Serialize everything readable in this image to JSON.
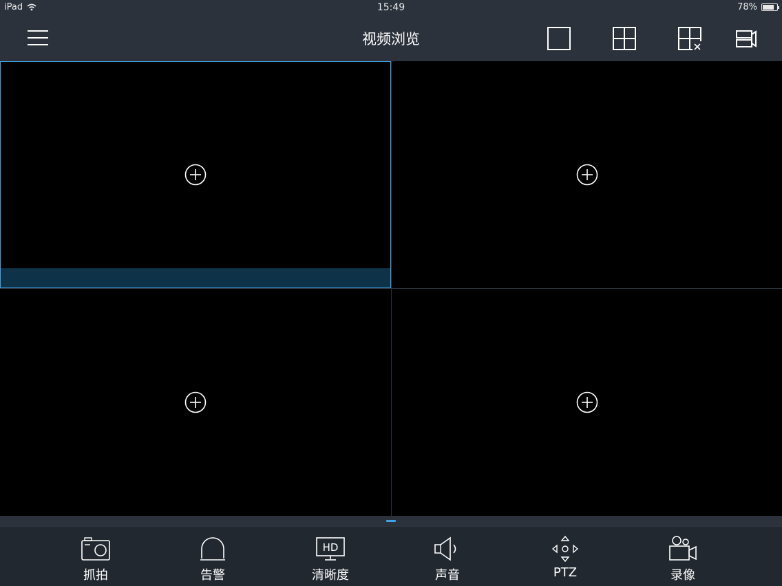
{
  "status_bar": {
    "device": "iPad",
    "time": "15:49",
    "battery": "78%",
    "battery_level": 0.78
  },
  "header": {
    "title": "视频浏览",
    "menu_icon": "hamburger-icon",
    "layout_single_icon": "single-view-icon",
    "layout_quad_icon": "quad-view-icon",
    "close_all_icon": "close-all-views-icon",
    "record_list_icon": "camera-list-icon"
  },
  "video_grid": {
    "cells": [
      {
        "name": "video-cell-1",
        "selected": true,
        "icon": "add-circle-icon"
      },
      {
        "name": "video-cell-2",
        "selected": false,
        "icon": "add-circle-icon"
      },
      {
        "name": "video-cell-3",
        "selected": false,
        "icon": "add-circle-icon"
      },
      {
        "name": "video-cell-4",
        "selected": false,
        "icon": "add-circle-icon"
      }
    ]
  },
  "toolbar": {
    "items": [
      {
        "label": "抓拍",
        "icon": "camera-icon"
      },
      {
        "label": "告警",
        "icon": "alarm-icon"
      },
      {
        "label": "清晰度",
        "icon": "hd-icon"
      },
      {
        "label": "声音",
        "icon": "speaker-icon"
      },
      {
        "label": "PTZ",
        "icon": "ptz-arrows-icon"
      },
      {
        "label": "录像",
        "icon": "video-camera-icon"
      }
    ]
  },
  "colors": {
    "background": "#2b323c",
    "toolbar": "#222830",
    "accent": "#3fa4e6",
    "selected_bar": "#0e3349"
  }
}
